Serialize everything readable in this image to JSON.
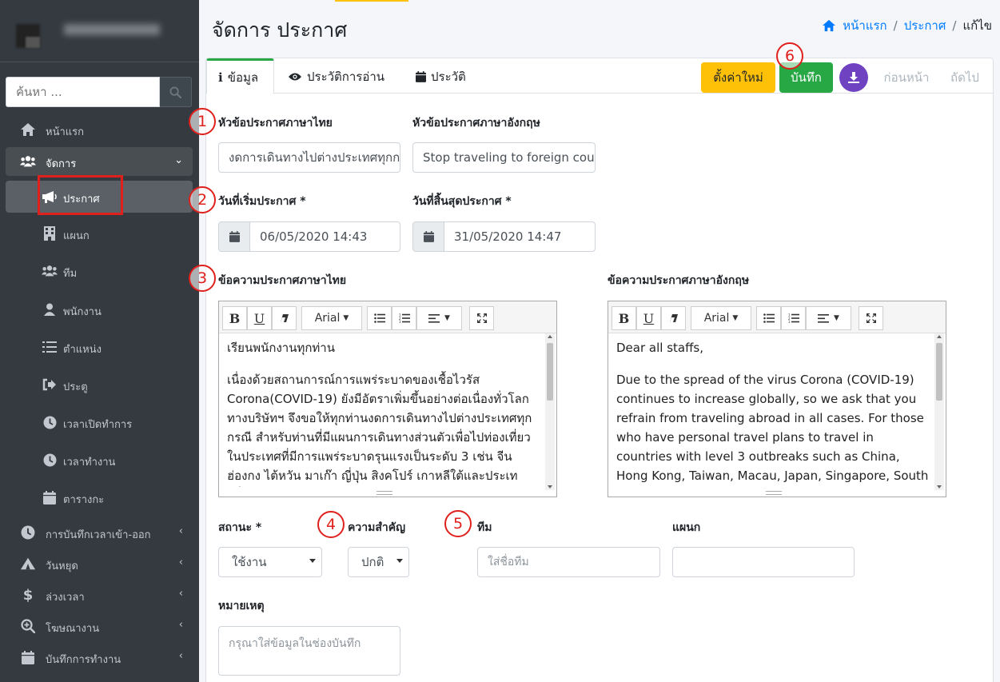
{
  "sidebar": {
    "search_placeholder": "ค้นหา ...",
    "items": [
      {
        "label": "หน้าแรก",
        "icon": "home-icon"
      },
      {
        "label": "จัดการ",
        "icon": "users-icon"
      },
      {
        "label": "ประกาศ",
        "icon": "megaphone-icon"
      },
      {
        "label": "แผนก",
        "icon": "building-icon"
      },
      {
        "label": "ทีม",
        "icon": "users-icon"
      },
      {
        "label": "พนักงาน",
        "icon": "user-icon"
      },
      {
        "label": "ตำแหน่ง",
        "icon": "list-icon"
      },
      {
        "label": "ประตู",
        "icon": "door-exit-icon"
      },
      {
        "label": "เวลาเปิดทำการ",
        "icon": "clock-icon"
      },
      {
        "label": "เวลาทำงาน",
        "icon": "clock-icon"
      },
      {
        "label": "ตารางกะ",
        "icon": "calendar-icon"
      },
      {
        "label": "การบันทึกเวลาเข้า-ออก",
        "icon": "clock-icon"
      },
      {
        "label": "วันหยุด",
        "icon": "tent-icon"
      },
      {
        "label": "ล่วงเวลา",
        "icon": "dollar-icon"
      },
      {
        "label": "โฆษณางาน",
        "icon": "search-plus-icon"
      },
      {
        "label": "บันทึกการทำงาน",
        "icon": "calendar-icon"
      }
    ]
  },
  "header": {
    "title": "จัดการ ประกาศ",
    "breadcrumb": [
      "หน้าแรก",
      "ประกาศ",
      "แก้ไข"
    ]
  },
  "tabs": [
    "ข้อมูล",
    "ประวัติการอ่าน",
    "ประวัติ"
  ],
  "toolbar": {
    "reset": "ตั้งค่าใหม่",
    "save": "บันทึก",
    "prev": "ก่อนหน้า",
    "next": "ถัดไป"
  },
  "form": {
    "title_th_label": "หัวข้อประกาศภาษาไทย",
    "title_th_value": "งดการเดินทางไปต่างประเทศทุกกรณี",
    "title_en_label": "หัวข้อประกาศภาษาอังกฤษ",
    "title_en_value": "Stop traveling to foreign countries",
    "start_label": "วันที่เริ่มประกาศ *",
    "start_value": "06/05/2020 14:43",
    "end_label": "วันที่สิ้นสุดประกาศ *",
    "end_value": "31/05/2020 14:47",
    "msg_th_label": "ข้อความประกาศภาษาไทย",
    "msg_en_label": "ข้อความประกาศภาษาอังกฤษ",
    "editor_font": "Arial",
    "msg_th_p1": "เรียนพนักงานทุกท่าน",
    "msg_th_p2": "เนื่องด้วยสถานการณ์การแพร่ระบาดของเชื้อไวรัส Corona(COVID-19) ยังมีอัตราเพิ่มขึ้นอย่างต่อเนื่องทั่วโลก ทางบริษัทฯ จึงขอให้ทุกท่านงดการเดินทางไปต่างประเทศทุกกรณี สำหรับท่านที่มีแผนการเดินทางส่วนตัวเพื่อไปท่องเที่ยวในประเทศที่มีการแพร่ระบาดรุนแรงเป็นระดับ 3 เช่น จีน ฮ่องกง ไต้หวัน มาเก๊า ญี่ปุ่น สิงคโปร์ เกาหลีใต้และประเทศอื่นๆ",
    "msg_en_p1": "Dear all staffs,",
    "msg_en_p2": "Due to the spread of the virus Corona (COVID-19) continues to increase globally, so we ask that you refrain from traveling abroad in all cases. For those who have personal travel plans to travel in countries with level 3 outbreaks such as China, Hong Kong, Taiwan, Macau, Japan, Singapore, South Korea and other countries, please postpone your trips.",
    "status_label": "สถานะ *",
    "status_value": "ใช้งาน",
    "priority_label": "ความสำคัญ",
    "priority_value": "ปกติ",
    "team_label": "ทีม",
    "team_placeholder": "ใส่ชื่อทีม",
    "dept_label": "แผนก",
    "note_label": "หมายเหตุ",
    "note_placeholder": "กรุณาใส่ข้อมูลในช่องบันทึก"
  },
  "markers": [
    "1",
    "2",
    "3",
    "4",
    "5",
    "6"
  ]
}
